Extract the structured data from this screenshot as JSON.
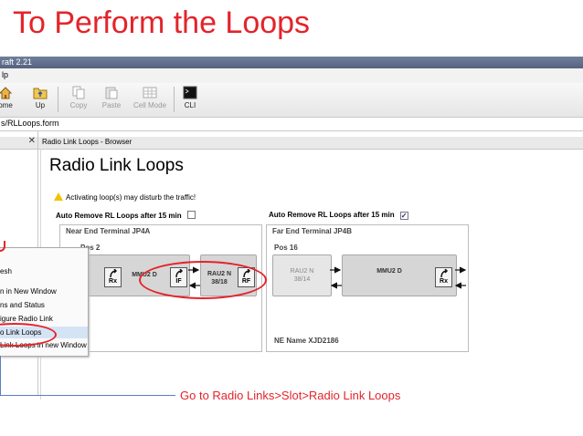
{
  "slide_title": "To Perform the Loops",
  "window_title_fragment": "raft 2.21",
  "menu_fragment": "lp",
  "toolbar": {
    "buttons": [
      {
        "label": "Home",
        "icon": "home-icon",
        "enabled": true
      },
      {
        "label": "Up",
        "icon": "folder-up-icon",
        "enabled": true
      },
      {
        "label": "Copy",
        "icon": "copy-icon",
        "enabled": false
      },
      {
        "label": "Paste",
        "icon": "paste-icon",
        "enabled": false
      },
      {
        "label": "Cell Mode",
        "icon": "cell-mode-icon",
        "enabled": false
      },
      {
        "label": "CLI",
        "icon": "terminal-icon",
        "enabled": true
      }
    ],
    "home_fragment": "ome"
  },
  "address_fragment": "s/RLLoops.form",
  "browser_tab": "Radio Link Loops - Browser",
  "page_heading": "Radio Link Loops",
  "warning": "Activating loop(s) may disturb the traffic!",
  "near_end": {
    "auto_remove_label": "Auto Remove RL Loops after 15 min",
    "auto_remove_checked": false,
    "title": "Near End Terminal  JP4A",
    "pos": "Pos  2",
    "mmu_label": "MMU2 D",
    "rau_label": "RAU2 N",
    "rau_sub": "38/18",
    "ports": {
      "rx": "Rx",
      "if": "IF",
      "rf": "RF"
    }
  },
  "far_end": {
    "auto_remove_label": "Auto Remove RL Loops after 15 min",
    "auto_remove_checked": true,
    "check_mark": "✓",
    "title": "Far End Terminal  JP4B",
    "pos": "Pos  16",
    "rau_label": "RAU2 N",
    "rau_sub": "38/14",
    "mmu_label": "MMU2 D",
    "ports": {
      "rx": "Rx"
    },
    "ne_name": "NE Name   XJD2186"
  },
  "context_menu": {
    "items": [
      {
        "label": "esh",
        "selected": false
      },
      {
        "label": "n in New Window",
        "selected": false
      },
      {
        "label": "ns and Status",
        "selected": false
      },
      {
        "label": "igure Radio Link",
        "selected": false
      },
      {
        "label": "o Link Loops",
        "selected": true
      },
      {
        "label": "Link Loops in new Window",
        "selected": false
      }
    ]
  },
  "instruction": "Go to Radio Links>Slot>Radio Link Loops",
  "colors": {
    "accent_red": "#e3242b",
    "callout_line": "#5b7fc0",
    "module_grey": "#d6d6d6"
  }
}
